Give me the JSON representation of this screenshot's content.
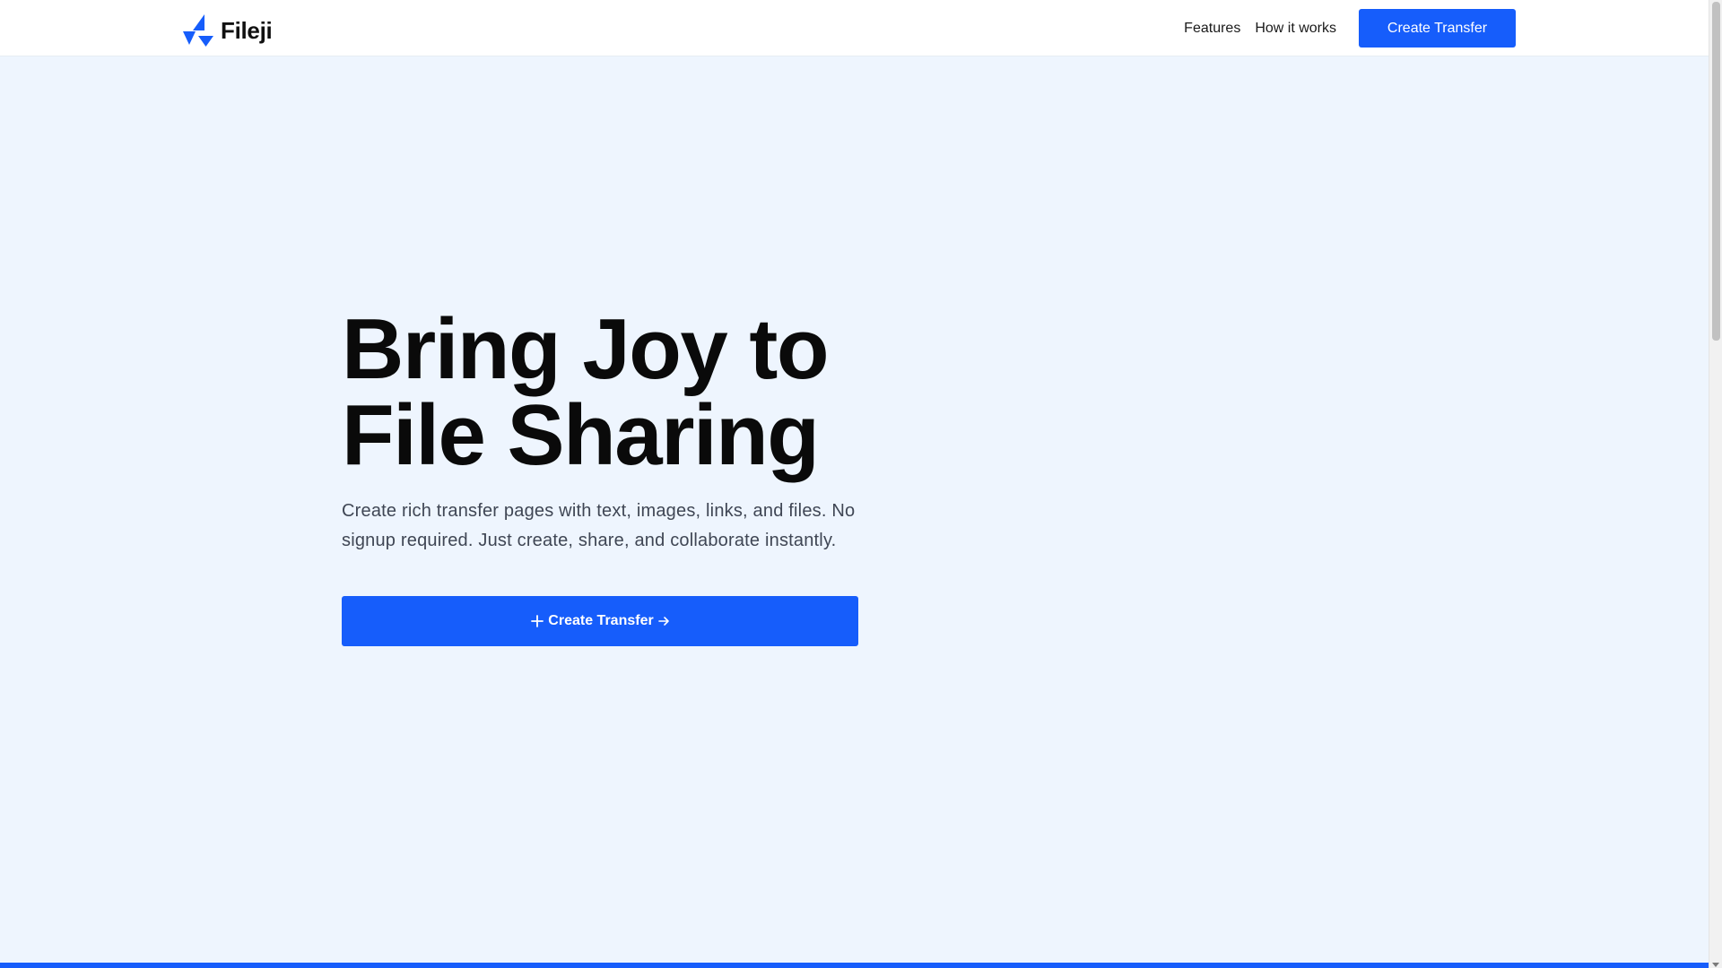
{
  "brand": {
    "name": "Fileji",
    "logo_icon": "fileji-logo-icon",
    "color": "#165dfb"
  },
  "nav": {
    "links": [
      "Features",
      "How it works"
    ],
    "cta_label": "Create Transfer"
  },
  "hero": {
    "title_line1": "Bring Joy to",
    "title_line2": "File Sharing",
    "subtitle": "Create rich transfer pages with text, images, links, and files. No signup required. Just create, share, and collaborate instantly.",
    "cta_label": "Create Transfer",
    "cta_leading_icon": "plus-icon",
    "cta_trailing_icon": "arrow-right-icon"
  },
  "colors": {
    "accent": "#165dfb",
    "background": "#eef5fe",
    "header_background": "#ffffff",
    "heading_text": "#0a0a0a",
    "body_text": "#3f4654"
  }
}
